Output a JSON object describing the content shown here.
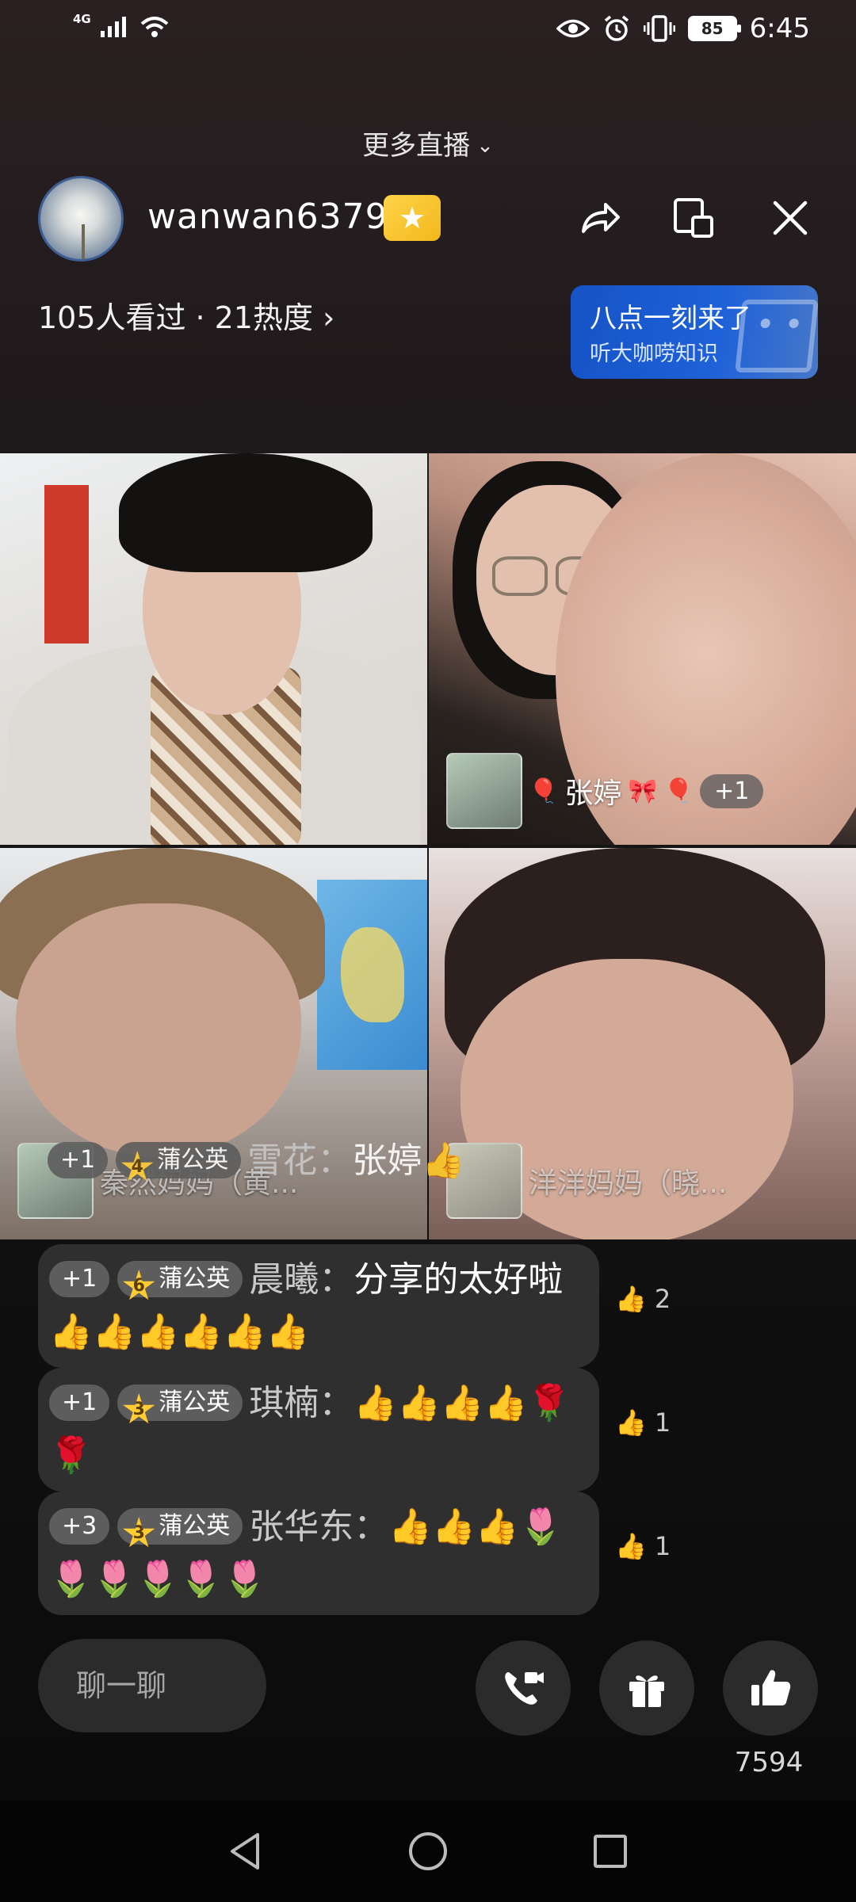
{
  "status_bar": {
    "network": "4G",
    "battery": "85",
    "time": "6:45"
  },
  "header": {
    "more_live": "更多直播",
    "host_name": "wanwan6379",
    "viewers": "105人看过",
    "separator": "·",
    "heat": "21热度"
  },
  "promo": {
    "title": "八点一刻来了",
    "subtitle": "听大咖唠知识"
  },
  "tiles": {
    "t2_guest_name": "张婷",
    "t2_plus": "+1",
    "t3_guest_name": "秦然妈妈（黄...",
    "t4_guest_name": "洋洋妈妈（晓..."
  },
  "chat": {
    "faded": {
      "plus": "+1",
      "level": "4",
      "badge": "蒲公英",
      "user": "雪花：",
      "text": "张婷👍"
    },
    "messages": [
      {
        "plus": "+1",
        "level": "6",
        "badge": "蒲公英",
        "user": "晨曦：",
        "text": "分享的太好啦👍👍👍👍👍👍",
        "likes": "2"
      },
      {
        "plus": "+1",
        "level": "3",
        "badge": "蒲公英",
        "user": "琪楠：",
        "text": "👍👍👍👍🌹🌹",
        "likes": "1"
      },
      {
        "plus": "+3",
        "level": "3",
        "badge": "蒲公英",
        "user": "张华东：",
        "text": "👍👍👍🌷🌷🌷🌷🌷🌷",
        "likes": "1"
      }
    ]
  },
  "bottom": {
    "chat_placeholder": "聊一聊",
    "like_count": "7594"
  }
}
